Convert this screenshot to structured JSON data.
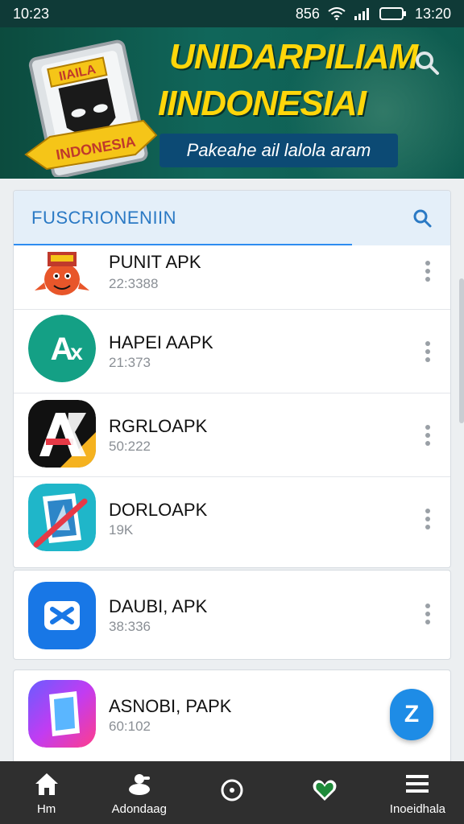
{
  "status_bar": {
    "time": "10:23",
    "right_text": "856",
    "battery_time": "13:20",
    "icons": [
      "wifi-icon",
      "signal-icon",
      "battery-icon"
    ]
  },
  "banner": {
    "logo_top_text": "IIAILA",
    "logo_ribbon_text": "INDONESIA",
    "title_line1": "UNIDARPILIAM",
    "title_line2": "IINDONESIAI",
    "subtitle": "Pakeahe ail lalola aram",
    "search_icon": "search-icon",
    "colors": {
      "bg": "#0c4b3e",
      "title": "#ffd60a",
      "subtitle_bg": "#0c4a74"
    }
  },
  "search": {
    "label": "FUSCRIONENIIN",
    "icon": "search-icon",
    "accent": "#2d8cf0"
  },
  "apps": [
    {
      "name": "PUNIT APK",
      "meta": "22:3388",
      "icon": "mascot-icon"
    },
    {
      "name": "HAPEI AAPK",
      "meta": "21:373",
      "icon": "ax-icon"
    },
    {
      "name": "RGRLOAPK",
      "meta": "50:222",
      "icon": "ak-icon"
    },
    {
      "name": "DORLOAPK",
      "meta": "19K",
      "icon": "document-icon"
    }
  ],
  "apps_more": [
    {
      "name": "DAUBI, APK",
      "meta": "38:336",
      "icon": "app-x-icon"
    },
    {
      "name": "ASNOBI, PAPK",
      "meta": "60:102",
      "icon": "gradient-app-icon"
    }
  ],
  "fab": {
    "label": "Z",
    "color": "#1e8ce6"
  },
  "bottom_nav": [
    {
      "label": "Hm",
      "icon": "home-icon"
    },
    {
      "label": "Adondaag",
      "icon": "download-icon"
    },
    {
      "label": "",
      "icon": "circle-icon"
    },
    {
      "label": "",
      "icon": "heart-shield-icon"
    },
    {
      "label": "Inoeidhala",
      "icon": "menu-icon"
    }
  ]
}
